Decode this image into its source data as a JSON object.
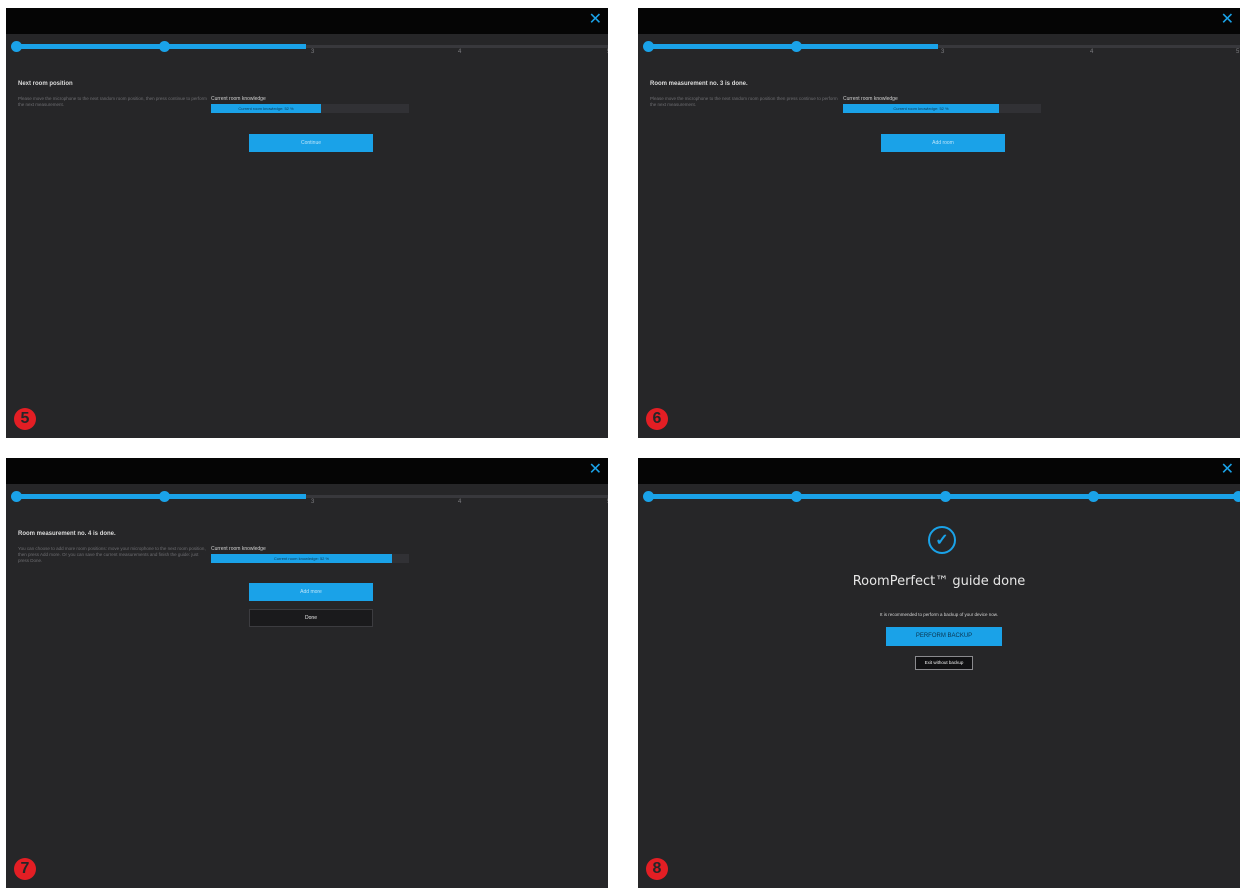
{
  "common": {
    "close_glyph": "✕",
    "knowledge_label": "Current room knowledge",
    "knowledge_bar_text": "Current room knowledge: 52 %"
  },
  "panel5": {
    "badge": "5",
    "steps": [
      "3",
      "4",
      "5"
    ],
    "heading": "Next room position",
    "description": "Please move the microphone to the next random room position, then press continue to perform the next measurement.",
    "knowledge_fraction": 0.55,
    "button": "Continue"
  },
  "panel6": {
    "badge": "6",
    "steps": [
      "3",
      "4",
      "5"
    ],
    "heading": "Room measurement no. 3 is done.",
    "description": "Please move the microphone to the next random room position then press continue to perform the next measurement.",
    "knowledge_fraction": 0.79,
    "button": "Add room"
  },
  "panel7": {
    "badge": "7",
    "steps": [
      "3",
      "4",
      "5"
    ],
    "heading": "Room measurement no. 4 is done.",
    "description": "You can choose to add more room positions: move your microphone to the next room position, then press Add more. Or you can save the current measurements and finish the guide: just press Done.",
    "knowledge_fraction": 0.9,
    "button_add": "Add more",
    "button_done": "Done"
  },
  "panel8": {
    "badge": "8",
    "title": "RoomPerfect™ guide done",
    "subtitle": "It is recommended to perform a backup of your device now.",
    "backup_button": "PERFORM BACKUP",
    "exit_button": "Exit without backup"
  },
  "colors": {
    "accent": "#1aa2e8",
    "background": "#262628",
    "badge": "#e31e24"
  }
}
